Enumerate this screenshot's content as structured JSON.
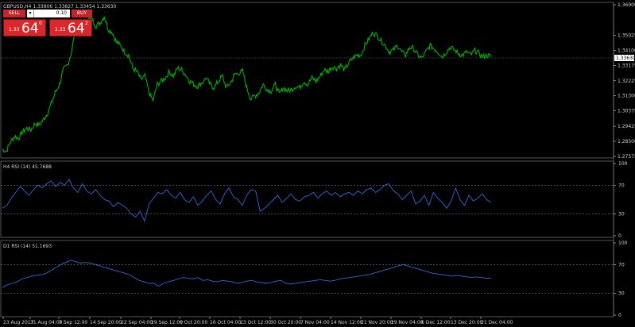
{
  "symbol_header": "GBPUSD,H4  1.33806 1.33827 1.33454 1.33630",
  "trade_panel": {
    "sell_label": "SELL",
    "buy_label": "BUY",
    "lot_value": "0.10",
    "sell_quote": {
      "base": "1.33",
      "big": "64",
      "sup": "0"
    },
    "buy_quote": {
      "base": "1.33",
      "big": "64",
      "sup": "2"
    }
  },
  "colors": {
    "price": "#00b000",
    "rsi": "#2a6ad8",
    "sell": "#c0262a",
    "axis": "#d0d0d0"
  },
  "chart_data": [
    {
      "type": "line",
      "title": "GBPUSD,H4  1.33806 1.33827 1.33454 1.33630",
      "ylim": [
        1.27575,
        1.369
      ],
      "y_ticks": [
        "1.36900",
        "1.35025",
        "1.34100",
        "1.33175",
        "1.32225",
        "1.31300",
        "1.30375",
        "1.29425",
        "1.28500",
        "1.27575"
      ],
      "current_price": "1.33630",
      "x": [
        0,
        1,
        2,
        3,
        4,
        5,
        6,
        7,
        8,
        9,
        10,
        11,
        12,
        13,
        14,
        15,
        16,
        17,
        18,
        19,
        20,
        21,
        22,
        23,
        24,
        25,
        26,
        27,
        28,
        29,
        30,
        31,
        32,
        33,
        34,
        35,
        36,
        37,
        38,
        39,
        40,
        41,
        42,
        43,
        44,
        45,
        46,
        47,
        48,
        49,
        50,
        51,
        52,
        53,
        54,
        55,
        56,
        57,
        58,
        59,
        60,
        61,
        62,
        63,
        64,
        65,
        66,
        67,
        68,
        69,
        70,
        71,
        72,
        73,
        74,
        75,
        76,
        77,
        78,
        79,
        80,
        81,
        82,
        83,
        84,
        85,
        86,
        87,
        88,
        89,
        90,
        91,
        92,
        93,
        94,
        95,
        96,
        97,
        98,
        99,
        100,
        101,
        102,
        103,
        104,
        105,
        106,
        107,
        108,
        109,
        110,
        111,
        112,
        113,
        114,
        115,
        116,
        117,
        118,
        119,
        120
      ],
      "series": [
        {
          "values": [
            1.28,
            1.279,
            1.285,
            1.288,
            1.287,
            1.291,
            1.293,
            1.292,
            1.296,
            1.295,
            1.298,
            1.302,
            1.308,
            1.315,
            1.32,
            1.329,
            1.332,
            1.34,
            1.356,
            1.358,
            1.352,
            1.36,
            1.36,
            1.356,
            1.358,
            1.362,
            1.354,
            1.352,
            1.346,
            1.344,
            1.34,
            1.338,
            1.33,
            1.328,
            1.323,
            1.325,
            1.315,
            1.31,
            1.32,
            1.322,
            1.324,
            1.328,
            1.325,
            1.33,
            1.329,
            1.326,
            1.322,
            1.32,
            1.319,
            1.321,
            1.324,
            1.32,
            1.318,
            1.322,
            1.325,
            1.318,
            1.321,
            1.326,
            1.327,
            1.328,
            1.318,
            1.311,
            1.313,
            1.315,
            1.32,
            1.317,
            1.316,
            1.32,
            1.314,
            1.318,
            1.316,
            1.317,
            1.319,
            1.318,
            1.322,
            1.32,
            1.324,
            1.322,
            1.325,
            1.329,
            1.328,
            1.331,
            1.33,
            1.332,
            1.329,
            1.333,
            1.336,
            1.338,
            1.338,
            1.344,
            1.348,
            1.352,
            1.35,
            1.347,
            1.344,
            1.34,
            1.341,
            1.344,
            1.34,
            1.338,
            1.343,
            1.342,
            1.338,
            1.336,
            1.34,
            1.344,
            1.342,
            1.34,
            1.337,
            1.34,
            1.343,
            1.341,
            1.339,
            1.338,
            1.34,
            1.338,
            1.341,
            1.339,
            1.337,
            1.338,
            1.337
          ]
        }
      ]
    },
    {
      "type": "line",
      "title": "H4 RSI (14) 45.7688",
      "ylim": [
        0,
        100
      ],
      "y_ticks": [
        "100",
        "70",
        "30",
        "0"
      ],
      "levels": [
        70,
        30
      ],
      "series": [
        {
          "values": [
            38,
            42,
            52,
            60,
            68,
            62,
            56,
            64,
            70,
            66,
            72,
            76,
            68,
            74,
            70,
            78,
            66,
            60,
            72,
            62,
            58,
            64,
            56,
            50,
            48,
            40,
            46,
            42,
            38,
            30,
            26,
            34,
            20,
            44,
            52,
            60,
            58,
            64,
            56,
            52,
            60,
            50,
            46,
            54,
            42,
            48,
            56,
            62,
            50,
            44,
            58,
            66,
            54,
            50,
            42,
            56,
            64,
            62,
            34,
            38,
            44,
            50,
            56,
            46,
            52,
            58,
            50,
            48,
            54,
            56,
            60,
            52,
            58,
            62,
            56,
            60,
            54,
            58,
            60,
            56,
            62,
            58,
            64,
            66,
            60,
            64,
            70,
            72,
            62,
            58,
            50,
            56,
            62,
            44,
            48,
            56,
            42,
            60,
            52,
            46,
            38,
            48,
            66,
            50,
            42,
            56,
            48,
            52,
            58,
            50,
            46
          ]
        }
      ]
    },
    {
      "type": "line",
      "title": "D1 RSI (14) 51.1693",
      "ylim": [
        0,
        100
      ],
      "y_ticks": [
        "100",
        "70",
        "30",
        "0"
      ],
      "levels": [
        70,
        30
      ],
      "series": [
        {
          "values": [
            38,
            42,
            44,
            46,
            50,
            52,
            54,
            55,
            56,
            58,
            62,
            66,
            70,
            73,
            76,
            74,
            72,
            73,
            72,
            70,
            68,
            66,
            64,
            62,
            60,
            58,
            56,
            52,
            48,
            46,
            44,
            44,
            40,
            44,
            46,
            48,
            50,
            52,
            51,
            50,
            52,
            48,
            49,
            47,
            46,
            48,
            47,
            46,
            44,
            45,
            47,
            48,
            46,
            45,
            44,
            45,
            47,
            48,
            44,
            43,
            44,
            45,
            46,
            47,
            48,
            49,
            48,
            47,
            48,
            50,
            51,
            52,
            53,
            54,
            55,
            56,
            58,
            60,
            62,
            64,
            66,
            68,
            70,
            68,
            66,
            64,
            62,
            60,
            58,
            57,
            56,
            55,
            54,
            55,
            54,
            53,
            52,
            53,
            52,
            51,
            51
          ]
        }
      ]
    }
  ],
  "panels": {
    "rsi_h4_label": "H4 RSI (14) 45.7688",
    "rsi_d1_label": "D1 RSI (14) 51.1693"
  },
  "rsi_ticks": [
    "100",
    "70",
    "30",
    "0"
  ],
  "x_labels": [
    "23 Aug 2017",
    "31 Aug 04:00",
    "7 Sep 12:00",
    "14 Sep 20:00",
    "22 Sep 04:00",
    "29 Sep 12:00",
    "6 Oct 20:00",
    "16 Oct 04:00",
    "23 Oct 12:00",
    "30 Oct 20:00",
    "7 Nov 04:00",
    "14 Nov 12:00",
    "21 Nov 20:00",
    "29 Nov 04:00",
    "6 Dec 12:00",
    "13 Dec 20:00",
    "21 Dec 04:00"
  ]
}
